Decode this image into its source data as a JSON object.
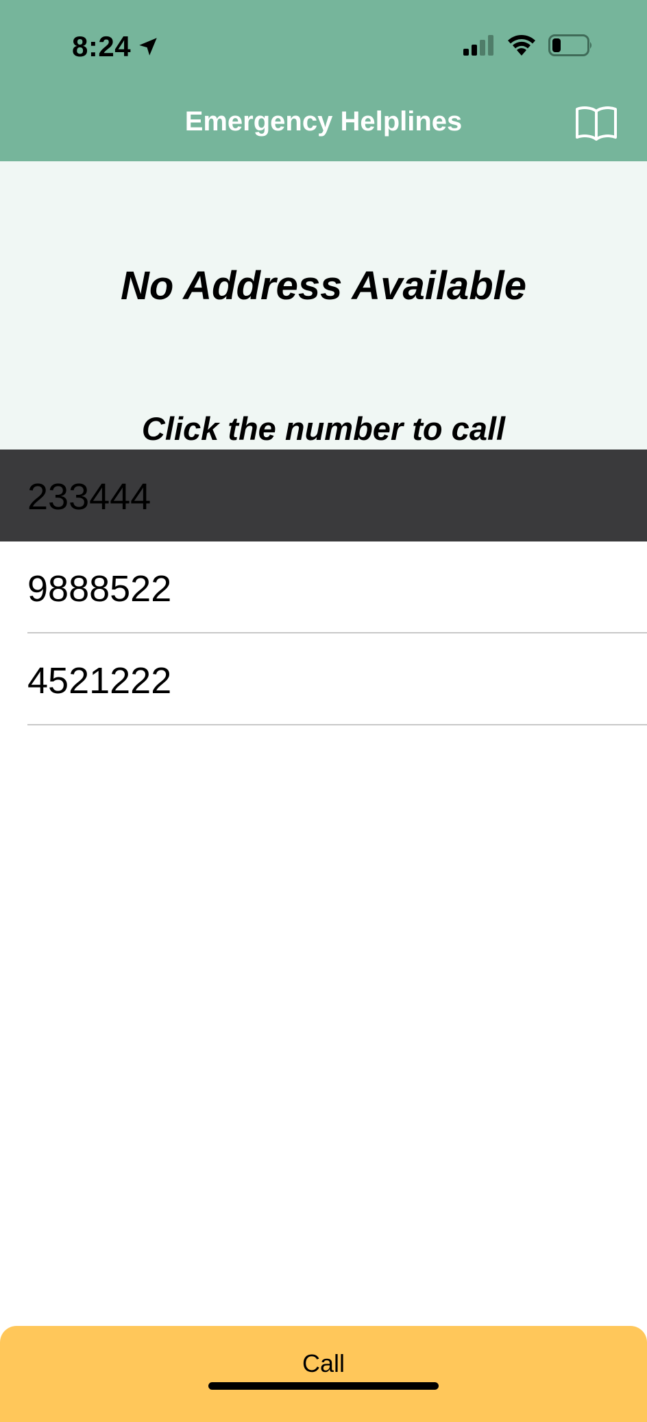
{
  "status_bar": {
    "time": "8:24",
    "location_icon": "location-arrow-icon",
    "signal_icon": "cellular-signal-icon",
    "wifi_icon": "wifi-icon",
    "battery_icon": "battery-low-icon"
  },
  "nav": {
    "title": "Emergency Helplines",
    "book_icon": "book-icon"
  },
  "info": {
    "address": "No Address Available",
    "instruction": "Click the number to call"
  },
  "helplines": [
    {
      "number": "233444",
      "selected": true
    },
    {
      "number": "9888522",
      "selected": false
    },
    {
      "number": "4521222",
      "selected": false
    }
  ],
  "call_button": {
    "label": "Call"
  },
  "colors": {
    "header": "#76b59b",
    "info_panel": "#f0f7f4",
    "selected_row": "#3a3a3c",
    "call_button": "#ffc75a"
  }
}
